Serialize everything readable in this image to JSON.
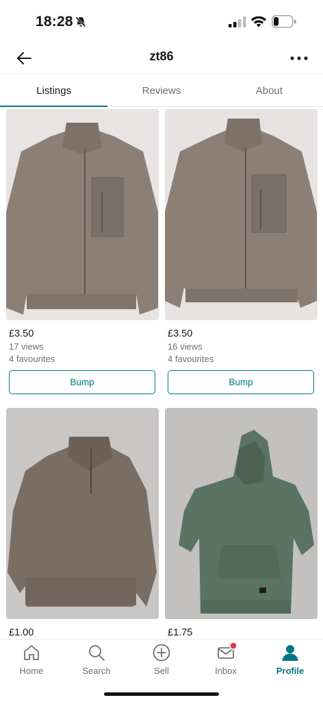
{
  "status_bar": {
    "time": "18:28"
  },
  "header": {
    "title": "zt86"
  },
  "tabs": [
    {
      "label": "Listings",
      "active": true
    },
    {
      "label": "Reviews",
      "active": false
    },
    {
      "label": "About",
      "active": false
    }
  ],
  "listings": [
    {
      "price": "£3.50",
      "views": "17 views",
      "favourites": "4 favourites",
      "action": "Bump",
      "item_color": "#8c7f76"
    },
    {
      "price": "£3.50",
      "views": "16 views",
      "favourites": "4 favourites",
      "action": "Bump",
      "item_color": "#8c7f76"
    },
    {
      "price": "£1.00",
      "item_color": "#7a6d63"
    },
    {
      "price": "£1.75",
      "item_color": "#5a7363"
    }
  ],
  "bottom_nav": [
    {
      "label": "Home",
      "icon": "home-icon"
    },
    {
      "label": "Search",
      "icon": "search-icon"
    },
    {
      "label": "Sell",
      "icon": "plus-circle-icon"
    },
    {
      "label": "Inbox",
      "icon": "inbox-icon",
      "badge": true
    },
    {
      "label": "Profile",
      "icon": "profile-icon",
      "active": true
    }
  ],
  "colors": {
    "accent": "#007782",
    "badge": "#e0324b"
  }
}
